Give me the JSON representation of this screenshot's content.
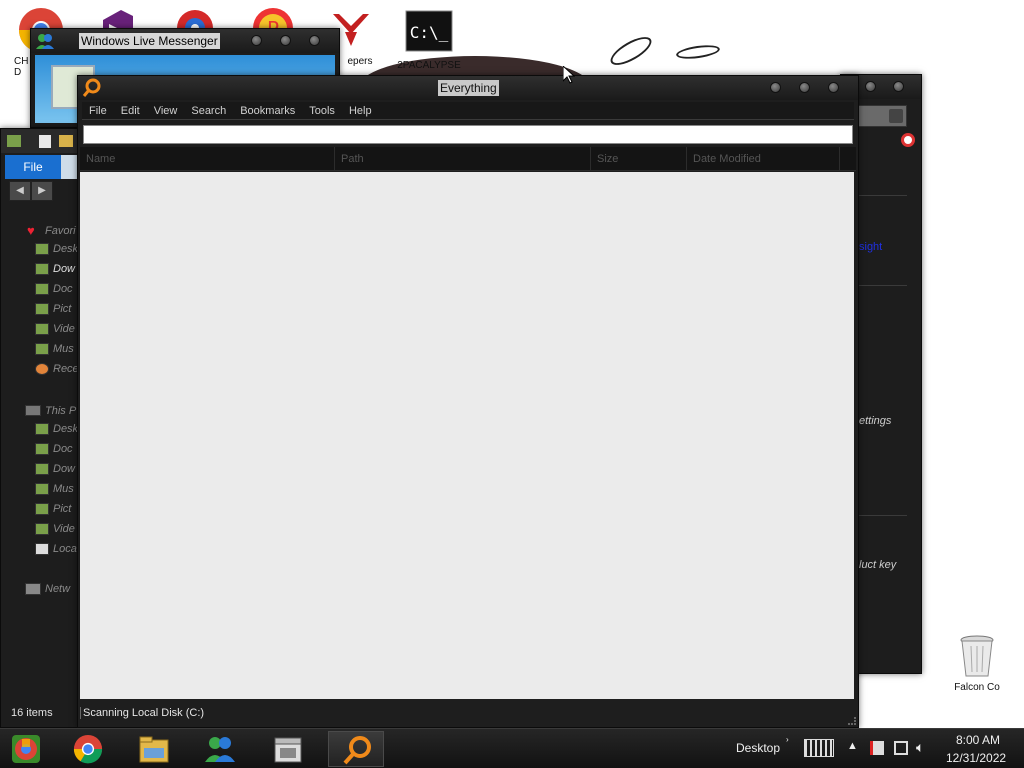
{
  "desktop": {
    "icons": [
      {
        "label": "CH\nD",
        "name": "chrome"
      },
      {
        "label": "",
        "name": "visual-studio"
      },
      {
        "label": "",
        "name": "app-red"
      },
      {
        "label": "",
        "name": "app-yellow"
      },
      {
        "label": "epers",
        "name": "papers-please"
      },
      {
        "label": "2PACALYPSE",
        "name": "cmd"
      }
    ],
    "recycle_bin_label": "Falcon Co"
  },
  "messenger": {
    "title": "Windows Live Messenger"
  },
  "explorer": {
    "file_tab": "File",
    "favorites_header": "Favori",
    "favorites": [
      "Desk",
      "Dow",
      "Doc",
      "Pict",
      "Vide",
      "Mus",
      "Rece"
    ],
    "thispc_header": "This P",
    "thispc_items": [
      "Desk",
      "Doc",
      "Dow",
      "Mus",
      "Pict",
      "Vide",
      "Loca"
    ],
    "network": "Netw",
    "status": "16 items"
  },
  "background_window": {
    "link_text": "sight",
    "settings_text": "ettings",
    "product_key_text": "luct key"
  },
  "everything": {
    "title": "Everything",
    "menu": [
      "File",
      "Edit",
      "View",
      "Search",
      "Bookmarks",
      "Tools",
      "Help"
    ],
    "search_value": "",
    "columns": [
      "Name",
      "Path",
      "Size",
      "Date Modified"
    ],
    "status": "Scanning Local Disk (C:)"
  },
  "taskbar": {
    "apps": [
      "chrome",
      "file-explorer",
      "messenger",
      "store",
      "everything"
    ],
    "desktop_label": "Desktop",
    "time": "8:00 AM",
    "date": "12/31/2022"
  }
}
